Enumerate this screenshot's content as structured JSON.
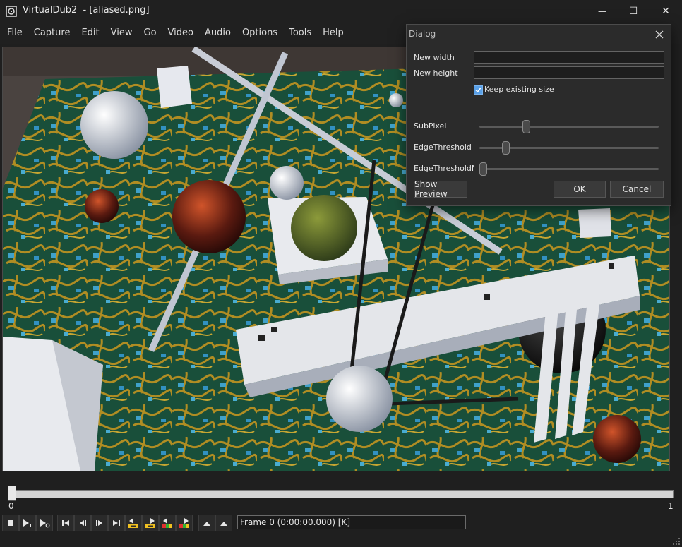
{
  "window": {
    "title": "VirtualDub2  - [aliased.png]",
    "controls": {
      "minimize": "—",
      "maximize": "☐",
      "close": "✕"
    }
  },
  "menu": [
    "File",
    "Capture",
    "Edit",
    "View",
    "Go",
    "Video",
    "Audio",
    "Options",
    "Tools",
    "Help"
  ],
  "timeline": {
    "start_label": "0",
    "end_label": "1",
    "position": 0
  },
  "toolbar": {
    "buttons": [
      "stop-icon",
      "play-input-icon",
      "play-output-icon",
      "go-start-icon",
      "step-back-icon",
      "step-forward-icon",
      "go-end-icon",
      "prev-key-icon",
      "next-key-icon",
      "scene-back-icon",
      "scene-forward-icon",
      "mark-in-icon",
      "mark-out-icon"
    ],
    "frame_text": "Frame 0 (0:00:00.000) [K]"
  },
  "dialog": {
    "title": "Dialog",
    "new_width_label": "New width",
    "new_width_value": "",
    "new_height_label": "New height",
    "new_height_value": "",
    "keep_size_label": "Keep existing size",
    "keep_size_checked": true,
    "sliders": [
      {
        "label": "SubPixel",
        "value": 0.25
      },
      {
        "label": "EdgeThreshold",
        "value": 0.13
      },
      {
        "label": "EdgeThresholdMir",
        "value": 0.0
      }
    ],
    "show_preview_label": "Show Preview",
    "ok_label": "OK",
    "cancel_label": "Cancel"
  },
  "colors": {
    "accent": "#5aa0e6",
    "background": "#1f1f1f",
    "board": "#1f5540"
  }
}
